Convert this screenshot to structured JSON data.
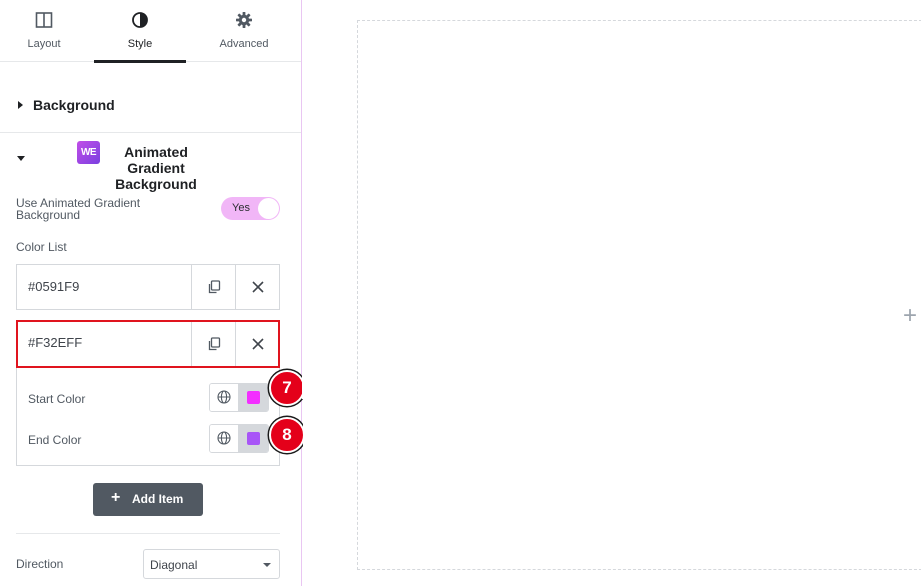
{
  "tabs": [
    {
      "label": "Layout",
      "icon": "layout-icon"
    },
    {
      "label": "Style",
      "icon": "style-icon",
      "active": true
    },
    {
      "label": "Advanced",
      "icon": "gear-icon"
    }
  ],
  "sections": {
    "background": {
      "title": "Background"
    },
    "animated_gradient": {
      "title": "Animated Gradient Background",
      "logo_text": "WE"
    }
  },
  "controls": {
    "use_animated": {
      "label": "Use Animated Gradient Background",
      "value": "Yes"
    },
    "color_list": {
      "label": "Color List",
      "items": [
        {
          "title": "#0591F9"
        },
        {
          "title": "#F32EFF"
        }
      ]
    },
    "start_color": {
      "label": "Start Color",
      "swatch": "#f32eff"
    },
    "end_color": {
      "label": "End Color",
      "swatch": "#a855f7"
    },
    "add_item": {
      "label": "Add Item"
    },
    "direction": {
      "label": "Direction",
      "value": "Diagonal"
    }
  },
  "markers": [
    "7",
    "8"
  ],
  "colors": {
    "accent": "#e9c6f2",
    "toggle_on": "#f1b6f7",
    "active_border": "#e0141e",
    "marker": "#e4001a",
    "button": "#515962"
  }
}
